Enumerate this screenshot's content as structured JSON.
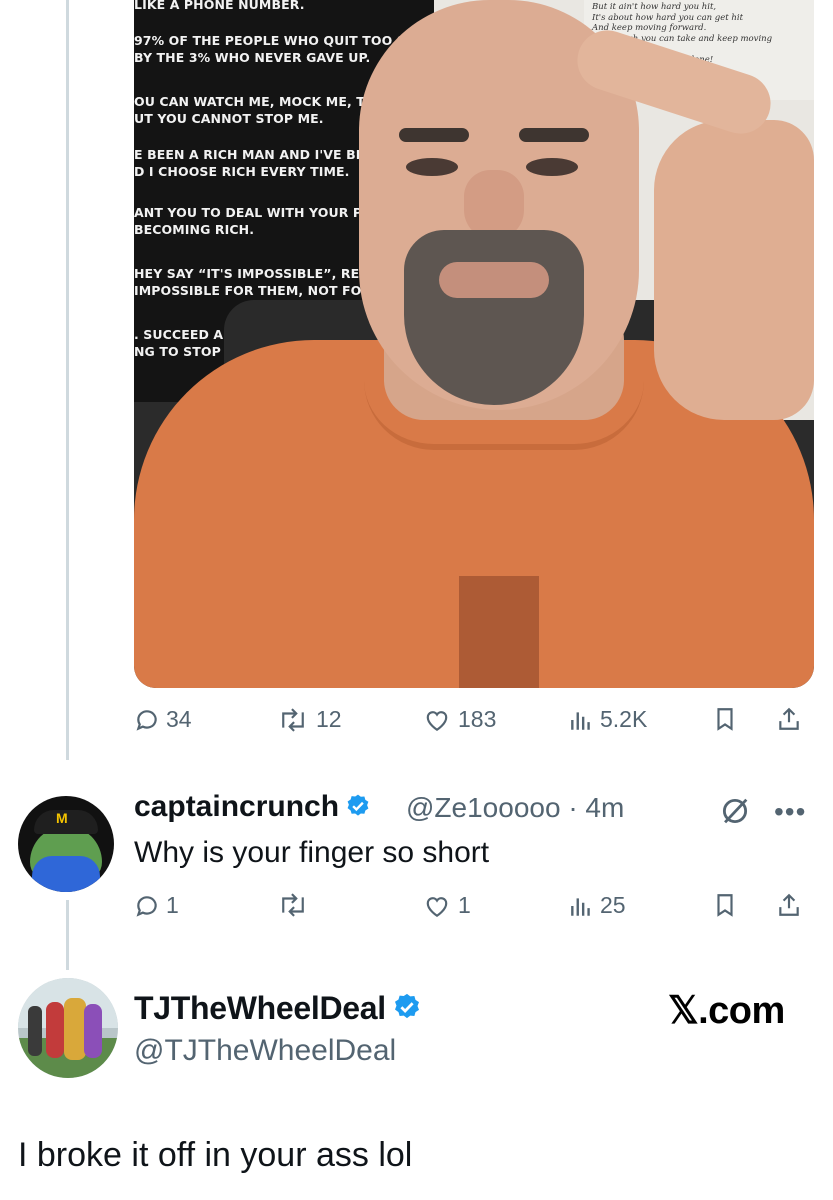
{
  "photo": {
    "poster_lines": [
      "LIKE A PHONE NUMBER.",
      "97% OF THE PEOPLE WHO QUIT TOO SOON AR",
      "BY THE 3% WHO NEVER GAVE UP.",
      "OU CAN WATCH ME, MOCK ME, TRY TO",
      "UT YOU CANNOT STOP ME.",
      "E BEEN A RICH MAN AND I'VE BEEN A",
      "D I CHOOSE RICH EVERY TIME.",
      "ANT YOU TO DEAL WITH YOUR PROBL",
      "BECOMING RICH.",
      "HEY SAY “IT'S IMPOSSIBLE”, REMEME",
      "IMPOSSIBLE FOR THEM, NOT FOR YOU",
      ". SUCCEED ANI",
      "NG TO STOP M"
    ],
    "poster_right_lines": [
      "But it ain't how hard you hit,",
      "It's about how hard you can get hit",
      "And keep moving forward.",
      "How much you can take and keep moving forward.",
      "That's how winning is done!"
    ]
  },
  "main_tweet_actions": {
    "replies": "34",
    "reposts": "12",
    "likes": "183",
    "views": "5.2K"
  },
  "reply": {
    "display_name": "captaincrunch",
    "handle_time": "@Ze1ooooo · 4m",
    "text": "Why is your finger so short",
    "avatar_badge": "M",
    "actions": {
      "replies": "1",
      "reposts": "",
      "likes": "1",
      "views": "25"
    }
  },
  "quoted": {
    "display_name": "TJTheWheelDeal",
    "handle": "@TJTheWheelDeal",
    "text": "I broke it off in your ass lol",
    "watermark": "𝕏.com"
  },
  "colors": {
    "muted": "#536471",
    "text": "#0f1419",
    "verified": "#1d9bf0",
    "thread_line": "#cfd9de"
  }
}
